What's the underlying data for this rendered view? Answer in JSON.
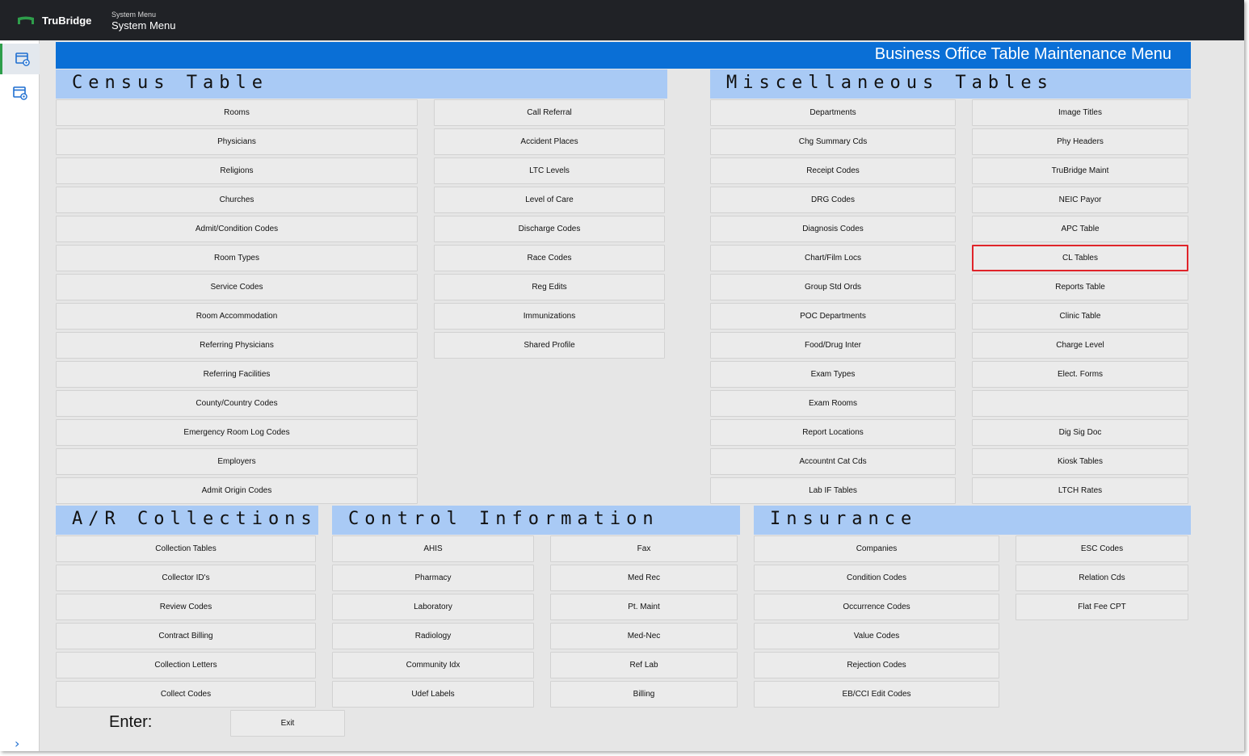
{
  "topbar": {
    "brand": "TruBridge",
    "breadcrumb_small": "System Menu",
    "breadcrumb_title": "System Menu",
    "brand_color": "#2e9e4b"
  },
  "sidebar": {
    "items": [
      {
        "icon": "window-settings-icon",
        "active": true
      },
      {
        "icon": "window-settings-icon",
        "active": false
      }
    ],
    "expand_icon": "chevron-right-icon"
  },
  "menu_title": "Business Office Table Maintenance Menu",
  "sections": {
    "census": {
      "title": "Census  Table",
      "col1": [
        "Rooms",
        "Physicians",
        "Religions",
        "Churches",
        "Admit/Condition Codes",
        "Room Types",
        "Service Codes",
        "Room Accommodation",
        "Referring Physicians",
        "Referring Facilities",
        "County/Country Codes",
        "Emergency Room Log Codes",
        "Employers",
        "Admit Origin Codes"
      ],
      "col2": [
        "Call Referral",
        "Accident Places",
        "LTC Levels",
        "Level of Care",
        "Discharge Codes",
        "Race Codes",
        "Reg Edits",
        "Immunizations",
        "Shared Profile"
      ]
    },
    "misc": {
      "title": "Miscellaneous  Tables",
      "col1": [
        "Departments",
        "Chg Summary Cds",
        "Receipt Codes",
        "DRG Codes",
        "Diagnosis Codes",
        "Chart/Film Locs",
        "Group Std Ords",
        "POC Departments",
        "Food/Drug Inter",
        "Exam Types",
        "Exam Rooms",
        "Report Locations",
        "Accountnt Cat Cds",
        "Lab IF Tables"
      ],
      "col2": [
        "Image Titles",
        "Phy Headers",
        "TruBridge Maint",
        "NEIC Payor",
        "APC Table",
        "CL Tables",
        "Reports Table",
        "Clinic Table",
        "Charge Level",
        "Elect. Forms",
        "",
        "Dig Sig Doc",
        "Kiosk Tables",
        "LTCH Rates"
      ],
      "selected": "CL Tables"
    },
    "ar": {
      "title": "A/R  Collections",
      "col1": [
        "Collection Tables",
        "Collector ID's",
        "Review Codes",
        "Contract Billing",
        "Collection Letters",
        "Collect Codes"
      ]
    },
    "control": {
      "title": "Control  Information",
      "col1": [
        "AHIS",
        "Pharmacy",
        "Laboratory",
        "Radiology",
        "Community Idx",
        "Udef Labels"
      ],
      "col2": [
        "Fax",
        "Med Rec",
        "Pt. Maint",
        "Med-Nec",
        "Ref Lab",
        "Billing"
      ]
    },
    "insurance": {
      "title": "Insurance",
      "col1": [
        "Companies",
        "Condition Codes",
        "Occurrence Codes",
        "Value Codes",
        "Rejection Codes",
        "EB/CCI Edit Codes"
      ],
      "col2": [
        "ESC Codes",
        "Relation Cds",
        "Flat Fee CPT"
      ]
    }
  },
  "footer": {
    "enter_label": "Enter:",
    "exit_label": "Exit"
  },
  "colors": {
    "title_band": "#0a6fd6",
    "section_header": "#a9caf5",
    "selected_border": "#e0242a"
  }
}
